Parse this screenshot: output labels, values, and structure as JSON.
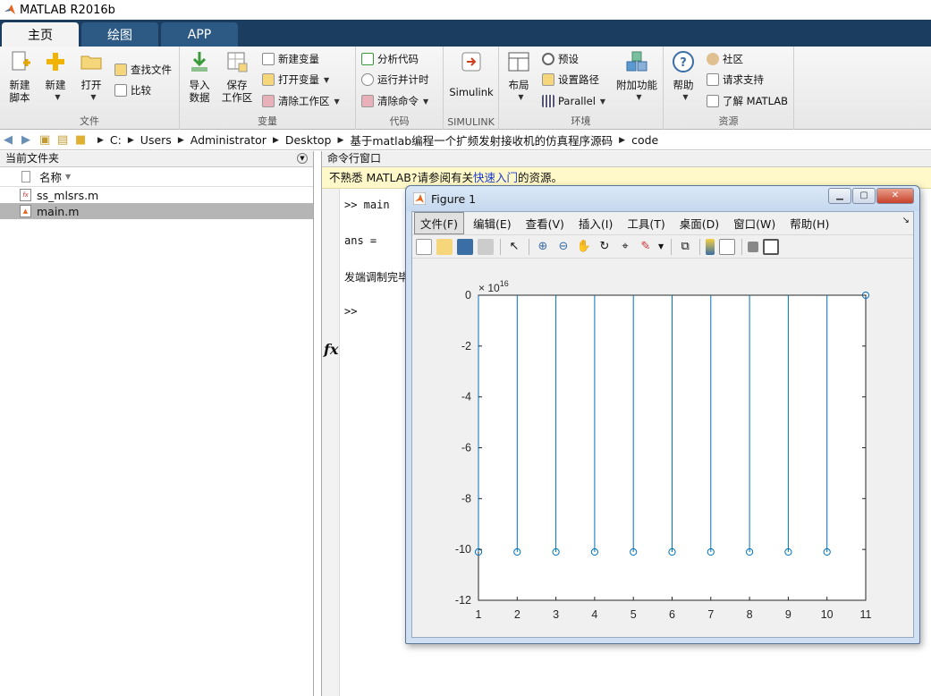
{
  "app": {
    "title": "MATLAB R2016b"
  },
  "tabs": [
    {
      "label": "主页",
      "active": true
    },
    {
      "label": "绘图",
      "active": false
    },
    {
      "label": "APP",
      "active": false
    }
  ],
  "ribbon": {
    "file": {
      "label": "文件",
      "new_script": [
        "新建",
        "脚本"
      ],
      "new": "新建",
      "open": "打开",
      "find_files": "查找文件",
      "compare": "比较"
    },
    "variable": {
      "label": "变量",
      "import": [
        "导入",
        "数据"
      ],
      "save_ws": [
        "保存",
        "工作区"
      ],
      "new_var": "新建变量",
      "open_var": "打开变量",
      "clear_ws": "清除工作区"
    },
    "code": {
      "label": "代码",
      "analyze": "分析代码",
      "run_time": "运行并计时",
      "clear_cmd": "清除命令"
    },
    "simulink": {
      "label": "SIMULINK",
      "simulink": "Simulink"
    },
    "env": {
      "label": "环境",
      "layout": "布局",
      "prefs": "预设",
      "set_path": "设置路径",
      "parallel": "Parallel",
      "addons": "附加功能"
    },
    "resources": {
      "label": "资源",
      "help": "帮助",
      "community": "社区",
      "request_support": "请求支持",
      "learn_matlab": "了解 MATLAB"
    }
  },
  "address": {
    "crumbs": [
      "C:",
      "Users",
      "Administrator",
      "Desktop",
      "基于matlab编程一个扩频发射接收机的仿真程序源码",
      "code"
    ]
  },
  "file_panel": {
    "title": "当前文件夹",
    "column_name": "名称",
    "files": [
      {
        "name": "ss_mlsrs.m",
        "selected": false
      },
      {
        "name": "main.m",
        "selected": true
      }
    ]
  },
  "command_window": {
    "title": "命令行窗口",
    "hint_prefix": "不熟悉 MATLAB?请参阅有关",
    "hint_link": "快速入门",
    "hint_suffix": "的资源。",
    "line1": ">> main",
    "line2": "ans =",
    "line3": "发端调制完毕",
    "prompt": ">>",
    "fx": "fx"
  },
  "figure": {
    "title": "Figure 1",
    "menus": [
      "文件(F)",
      "编辑(E)",
      "查看(V)",
      "插入(I)",
      "工具(T)",
      "桌面(D)",
      "窗口(W)",
      "帮助(H)"
    ],
    "exponent_base": "× 10",
    "exponent_power": "16"
  },
  "chart_data": {
    "type": "stem",
    "x": [
      1,
      2,
      3,
      4,
      5,
      6,
      7,
      8,
      9,
      10,
      11
    ],
    "y": [
      -10.1,
      -10.1,
      -10.1,
      -10.1,
      -10.1,
      -10.1,
      -10.1,
      -10.1,
      -10.1,
      -10.1,
      0
    ],
    "y_scale_exponent": 16,
    "xlim": [
      1,
      11
    ],
    "ylim": [
      -12,
      0
    ],
    "xticks": [
      1,
      2,
      3,
      4,
      5,
      6,
      7,
      8,
      9,
      10,
      11
    ],
    "yticks": [
      0,
      -2,
      -4,
      -6,
      -8,
      -10,
      -12
    ],
    "color": "#0072bd",
    "grid": false
  }
}
